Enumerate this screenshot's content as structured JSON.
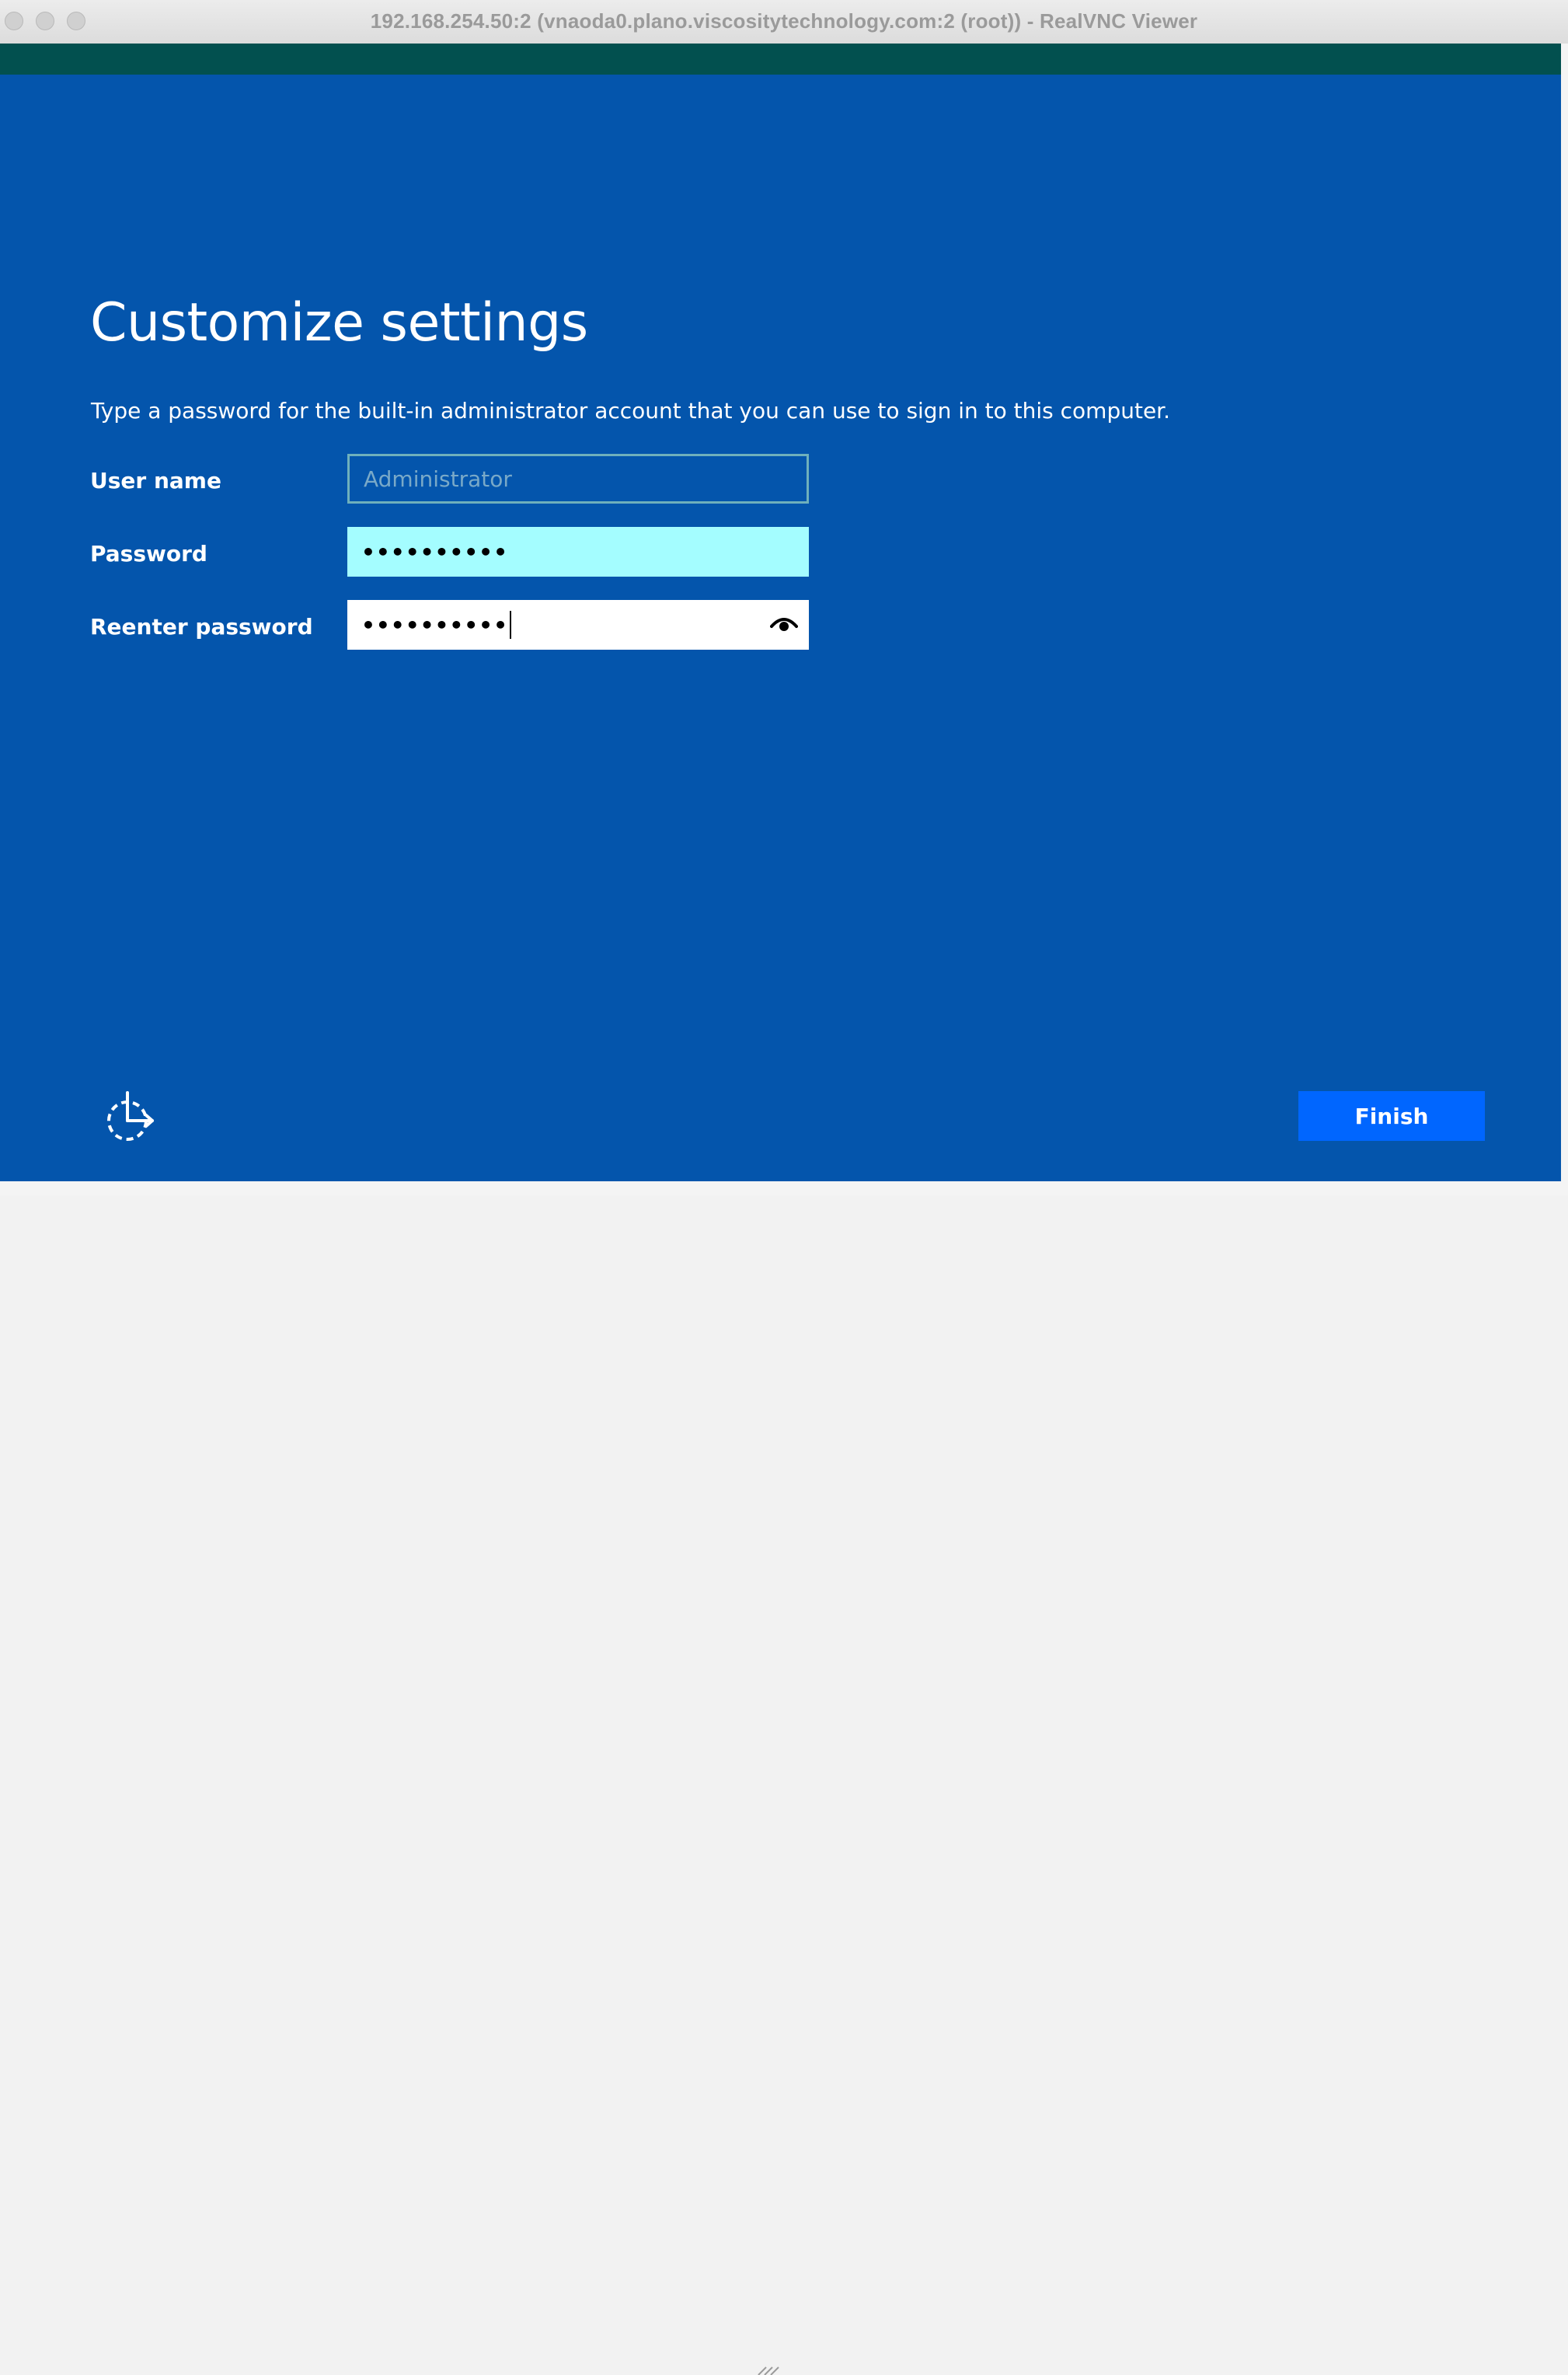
{
  "window": {
    "title": "192.168.254.50:2 (vnaoda0.plano.viscositytechnology.com:2 (root)) - RealVNC Viewer"
  },
  "setup": {
    "title": "Customize settings",
    "instructions": "Type a password for the built-in administrator account that you can use to sign in to this computer.",
    "username_label": "User name",
    "username_value": "Administrator",
    "password_label": "Password",
    "password_value": "••••••••••",
    "reenter_label": "Reenter password",
    "reenter_value": "••••••••••",
    "finish_label": "Finish"
  },
  "icons": {
    "reveal": "eye-icon",
    "accessibility": "ease-of-access-icon"
  },
  "colors": {
    "background": "#0455ac",
    "header_band": "#02504f",
    "password_focus": "#a4fdff",
    "finish_button": "#0066ff"
  }
}
